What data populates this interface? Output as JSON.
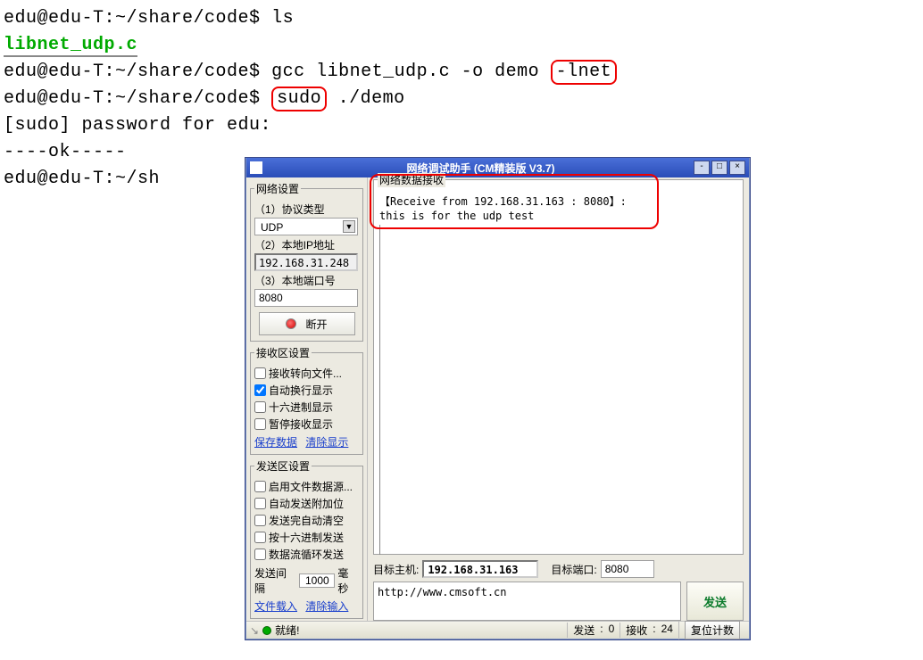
{
  "terminal": {
    "prompt": "edu@edu-T:~/share/code$",
    "prompt_short": "edu@edu-T:~/sh",
    "cmd_ls": "ls",
    "file": "libnet_udp.c",
    "cmd_gcc_pre": "gcc libnet_udp.c -o demo",
    "flag_lnet": "-lnet",
    "sudo": "sudo",
    "cmd_demo": " ./demo",
    "pwd_prompt": "[sudo] password for edu:",
    "ok_line": "----ok-----"
  },
  "dialog": {
    "title": "网络调试助手 (CM精装版 V3.7)",
    "net_settings": {
      "legend": "网络设置",
      "proto_label": "（1）协议类型",
      "proto_value": "UDP",
      "ip_label": "（2）本地IP地址",
      "ip_value": "192.168.31.248",
      "port_label": "（3）本地端口号",
      "port_value": "8080",
      "disconnect_label": "断开"
    },
    "recv_settings": {
      "legend": "接收区设置",
      "opt1": "接收转向文件...",
      "opt2": "自动换行显示",
      "opt3": "十六进制显示",
      "opt4": "暂停接收显示",
      "link_save": "保存数据",
      "link_clear": "清除显示"
    },
    "send_settings": {
      "legend": "发送区设置",
      "opt1": "启用文件数据源...",
      "opt2": "自动发送附加位",
      "opt3": "发送完自动清空",
      "opt4": "按十六进制发送",
      "opt5": "数据流循环发送",
      "interval_label_pre": "发送间隔",
      "interval_value": "1000",
      "interval_label_post": "毫秒",
      "link_load": "文件载入",
      "link_clear": "清除输入"
    },
    "recv_area": {
      "legend": "网络数据接收",
      "line1": "【Receive from 192.168.31.163 : 8080】:",
      "line2": "this is for the udp test"
    },
    "target": {
      "host_label": "目标主机:",
      "host_value": "192.168.31.163",
      "port_label": "目标端口:",
      "port_value": "8080"
    },
    "send": {
      "text": "http://www.cmsoft.cn",
      "button": "发送"
    },
    "status": {
      "ready": "就绪!",
      "send_label": "发送",
      "send_count": "0",
      "recv_label": "接收",
      "recv_count": "24",
      "reset_btn": "复位计数"
    }
  }
}
